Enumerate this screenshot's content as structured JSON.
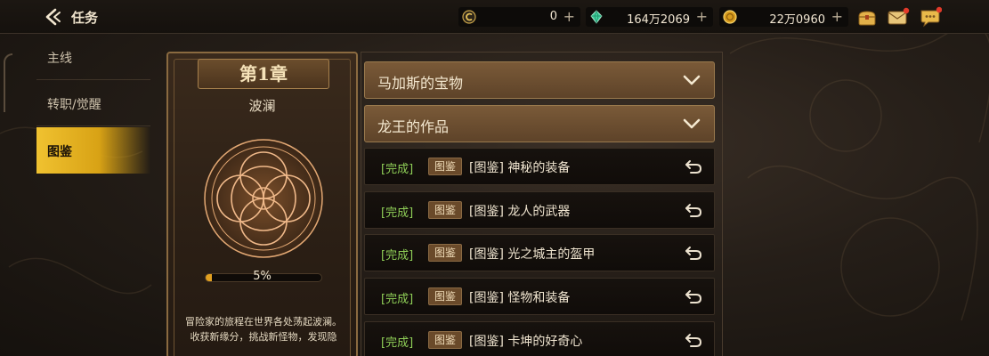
{
  "header": {
    "title": "任务",
    "resources": [
      {
        "icon": "gold-coin-c-icon",
        "value": "0"
      },
      {
        "icon": "green-gem-icon",
        "value": "164万2069"
      },
      {
        "icon": "gold-medal-icon",
        "value": "22万0960"
      }
    ],
    "plus": "+",
    "icons": [
      "treasure-bag-icon",
      "mail-icon",
      "chat-icon"
    ]
  },
  "sidebar": {
    "items": [
      {
        "label": "主线",
        "active": false
      },
      {
        "label": "转职/觉醒",
        "active": false
      },
      {
        "label": "图鉴",
        "active": true
      }
    ]
  },
  "chapter": {
    "title": "第1章",
    "subtitle": "波澜",
    "progress": 5,
    "progress_text": "5%",
    "description": "冒险家的旅程在世界各处荡起波澜。收获新缘分，挑战新怪物，发现隐"
  },
  "groups": [
    {
      "title": "马加斯的宝物"
    },
    {
      "title": "龙王的作品"
    }
  ],
  "quests": [
    {
      "status": "[完成]",
      "tag": "图鉴",
      "title": "[图鉴] 神秘的装备"
    },
    {
      "status": "[完成]",
      "tag": "图鉴",
      "title": "[图鉴] 龙人的武器"
    },
    {
      "status": "[完成]",
      "tag": "图鉴",
      "title": "[图鉴] 光之城主的盔甲"
    },
    {
      "status": "[完成]",
      "tag": "图鉴",
      "title": "[图鉴] 怪物和装备"
    },
    {
      "status": "[完成]",
      "tag": "图鉴",
      "title": "[图鉴] 卡坤的好奇心"
    }
  ],
  "colors": {
    "accent": "#e8b424",
    "complete": "#8fcf57",
    "group_bg": "#6c4e31"
  }
}
